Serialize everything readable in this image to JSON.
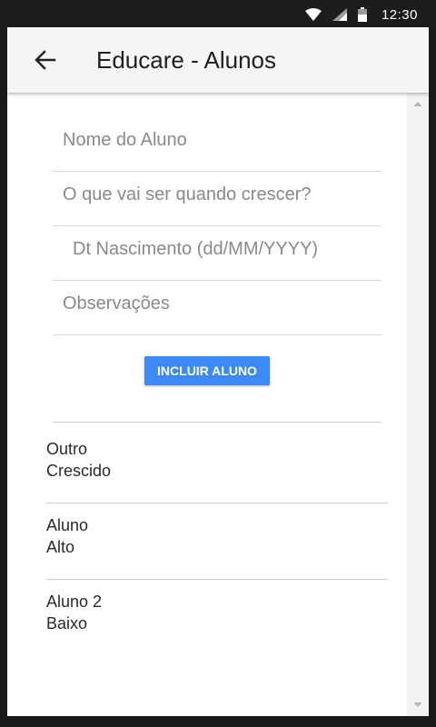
{
  "status_bar": {
    "time": "12:30",
    "icons": [
      "wifi-icon",
      "signal-icon",
      "battery-icon"
    ]
  },
  "app_bar": {
    "back_icon": "arrow-left-icon",
    "title": "Educare - Alunos",
    "background": "#f5f5f5"
  },
  "form": {
    "name_placeholder": "Nome do Aluno",
    "dream_placeholder": "O que vai ser quando crescer?",
    "birth_placeholder": "Dt Nascimento (dd/MM/YYYY)",
    "notes_placeholder": "Observações",
    "name_value": "",
    "dream_value": "",
    "birth_value": "",
    "notes_value": "",
    "submit_label": "INCLUIR ALUNO",
    "submit_color": "#3d8af7"
  },
  "students": [
    {
      "name": "Outro",
      "dream": "Crescido"
    },
    {
      "name": "Aluno",
      "dream": "Alto"
    },
    {
      "name": "Aluno 2",
      "dream": "Baixo"
    }
  ]
}
